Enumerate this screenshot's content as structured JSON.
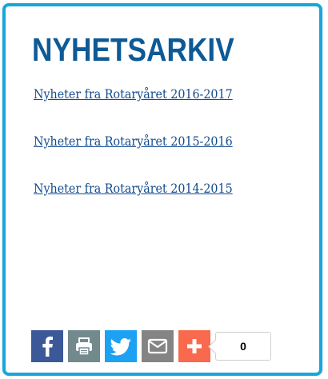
{
  "widget": {
    "title": "NYHETSARKIV",
    "links": [
      {
        "label": "Nyheter fra Rotaryåret 2016-2017"
      },
      {
        "label": "Nyheter fra Rotaryåret 2015-2016"
      },
      {
        "label": "Nyheter fra Rotaryåret 2014-2015"
      }
    ]
  },
  "share": {
    "buttons": [
      {
        "name": "facebook",
        "icon": "facebook-icon",
        "color": "#3b5998"
      },
      {
        "name": "print",
        "icon": "printer-icon",
        "color": "#738a8d"
      },
      {
        "name": "twitter",
        "icon": "twitter-icon",
        "color": "#1da1f2"
      },
      {
        "name": "email",
        "icon": "envelope-icon",
        "color": "#848484"
      },
      {
        "name": "more",
        "icon": "plus-icon",
        "color": "#f8694d"
      }
    ],
    "count": "0"
  },
  "colors": {
    "border": "#17a7dc",
    "title": "#0d5a96",
    "link": "#134b8e"
  }
}
